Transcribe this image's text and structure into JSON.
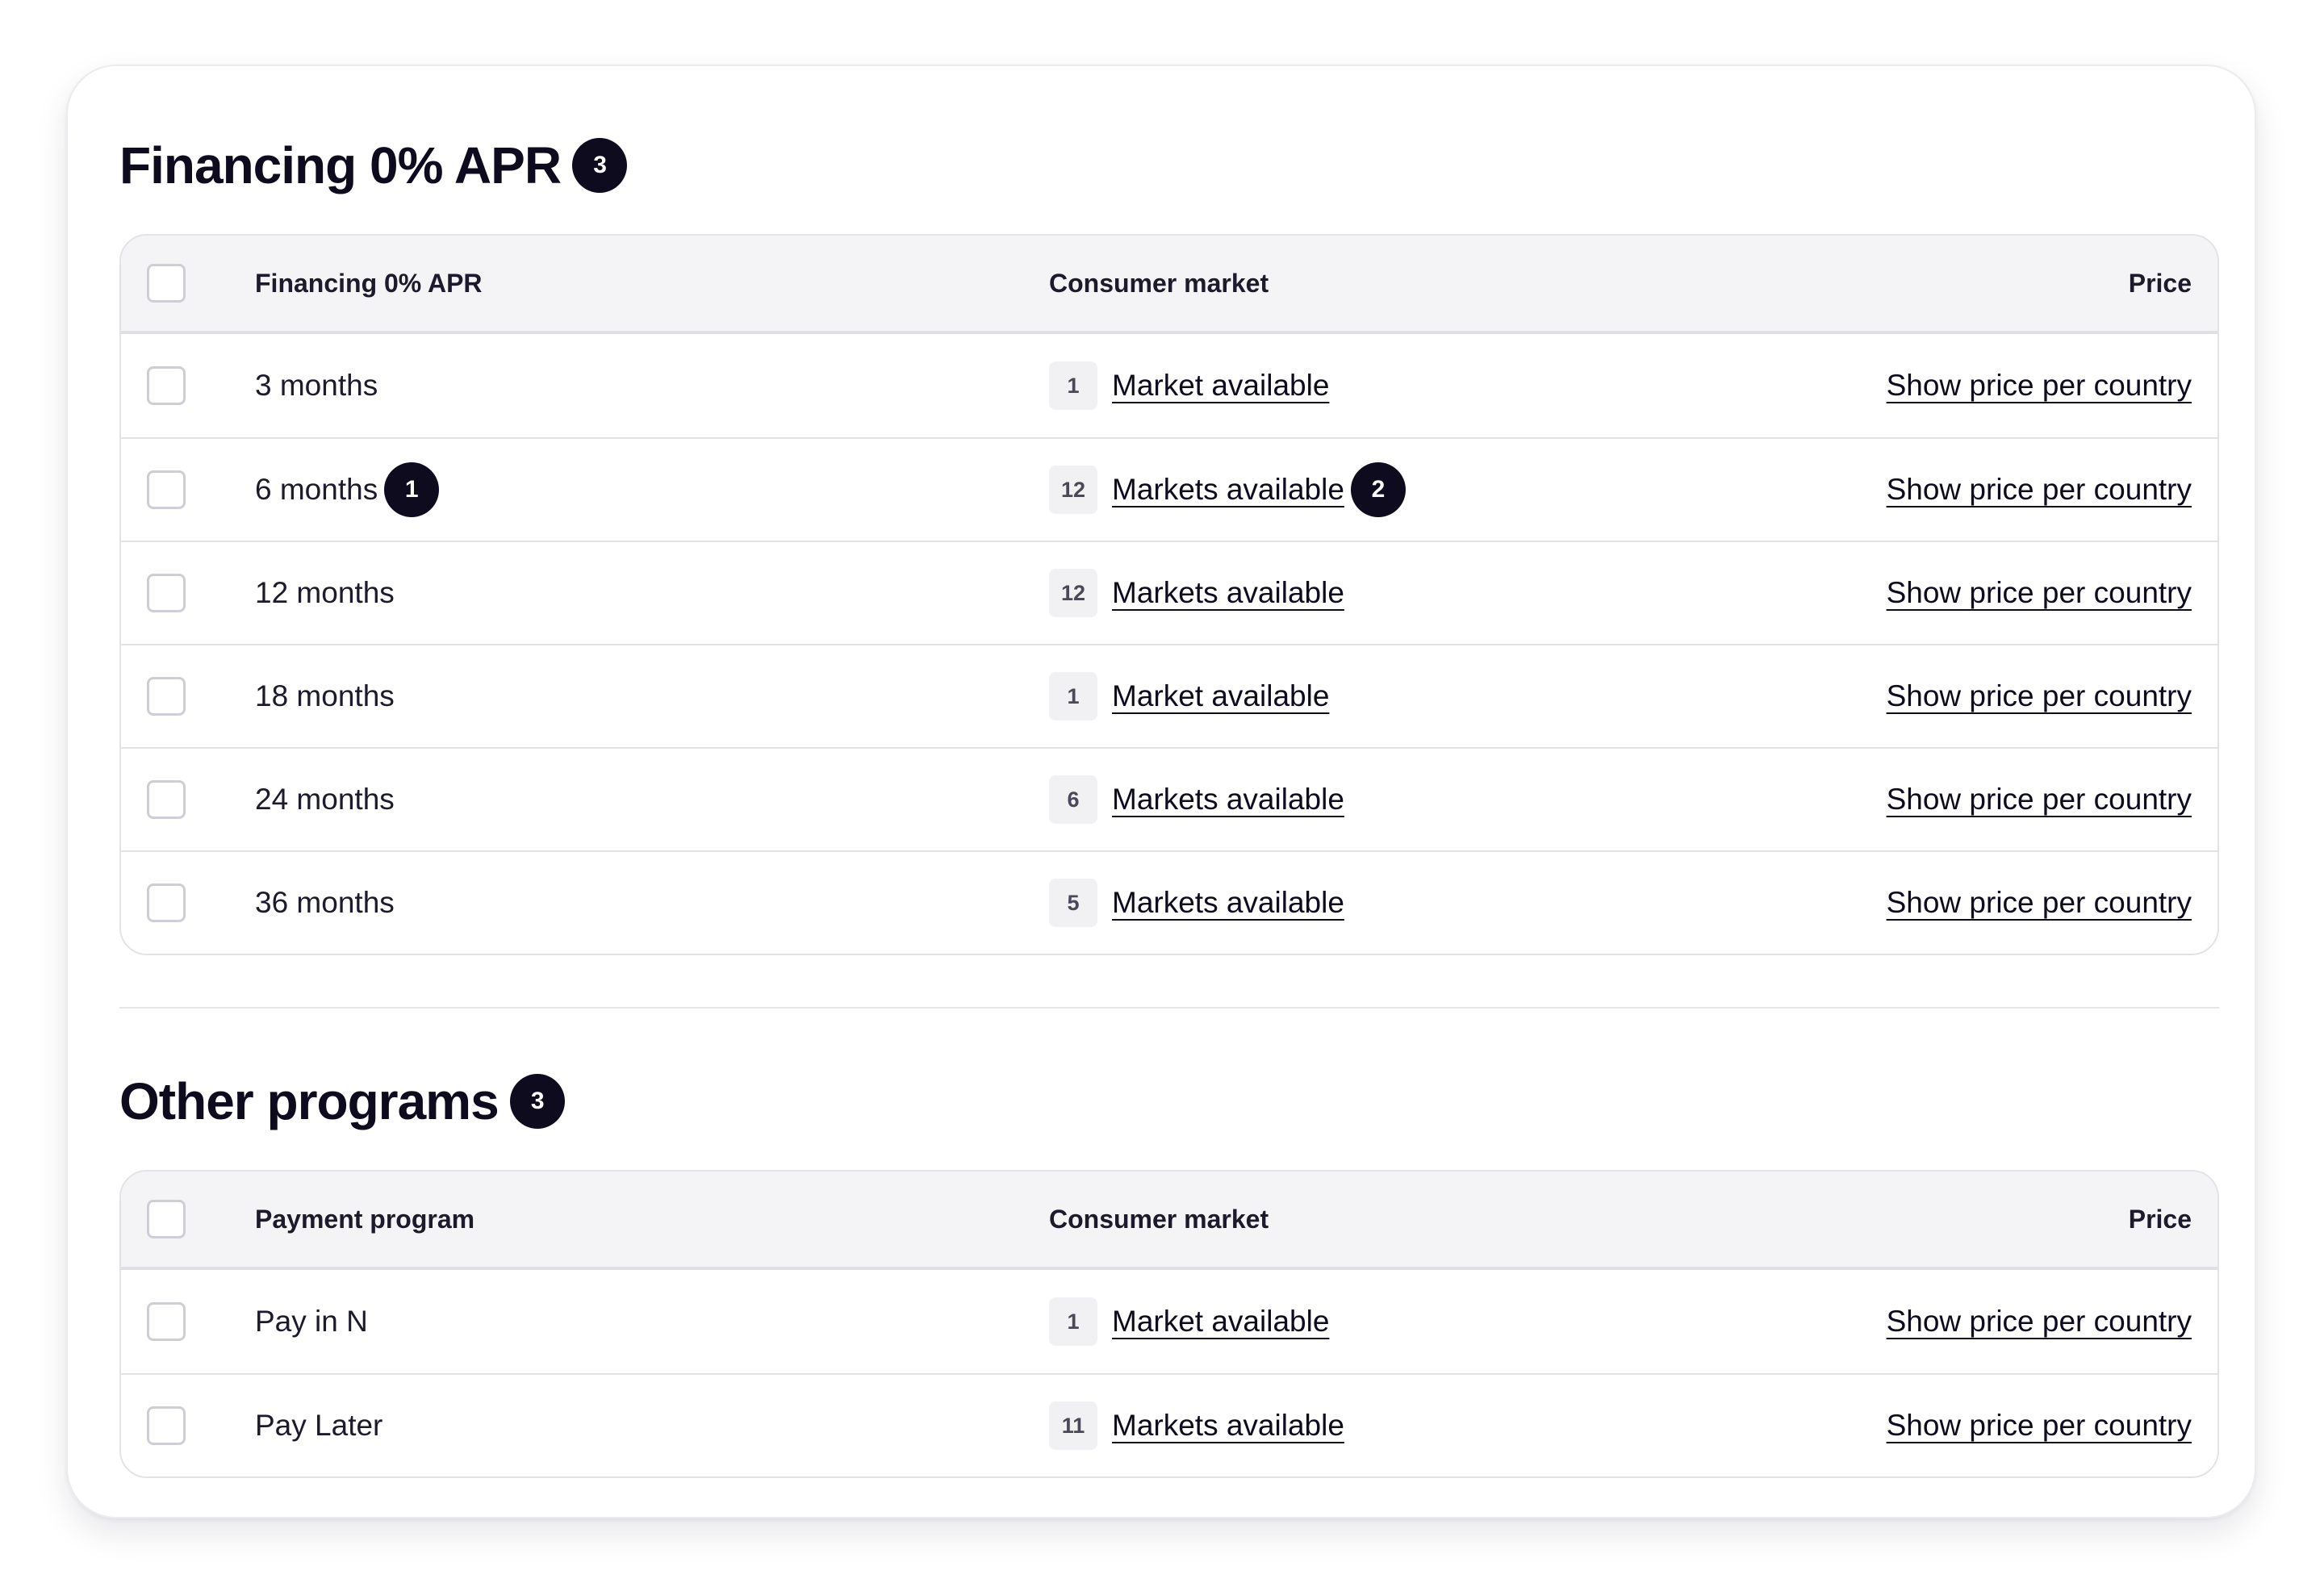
{
  "sections": [
    {
      "title": "Financing 0% APR",
      "badge": "3",
      "columns": {
        "name": "Financing 0% APR",
        "market": "Consumer market",
        "price": "Price"
      },
      "rows": [
        {
          "name": "3 months",
          "count": "1",
          "market": "Market available",
          "price": "Show price per country",
          "name_badge": "",
          "market_badge": ""
        },
        {
          "name": "6 months",
          "count": "12",
          "market": "Markets available",
          "price": "Show price per country",
          "name_badge": "1",
          "market_badge": "2"
        },
        {
          "name": "12 months",
          "count": "12",
          "market": "Markets available",
          "price": "Show price per country",
          "name_badge": "",
          "market_badge": ""
        },
        {
          "name": "18 months",
          "count": "1",
          "market": "Market available",
          "price": "Show price per country",
          "name_badge": "",
          "market_badge": ""
        },
        {
          "name": "24 months",
          "count": "6",
          "market": "Markets available",
          "price": "Show price per country",
          "name_badge": "",
          "market_badge": ""
        },
        {
          "name": "36 months",
          "count": "5",
          "market": "Markets available",
          "price": "Show price per country",
          "name_badge": "",
          "market_badge": ""
        }
      ]
    },
    {
      "title": "Other programs",
      "badge": "3",
      "columns": {
        "name": "Payment program",
        "market": "Consumer market",
        "price": "Price"
      },
      "rows": [
        {
          "name": "Pay in N",
          "count": "1",
          "market": "Market available",
          "price": "Show price per country",
          "name_badge": "",
          "market_badge": ""
        },
        {
          "name": "Pay Later",
          "count": "11",
          "market": "Markets available",
          "price": "Show price per country",
          "name_badge": "",
          "market_badge": ""
        }
      ]
    }
  ],
  "colors": {
    "accent": "#0e0b1f",
    "header_bg": "#f4f4f6",
    "border": "#e3e2e7",
    "count_bg": "#f1f0f3"
  }
}
